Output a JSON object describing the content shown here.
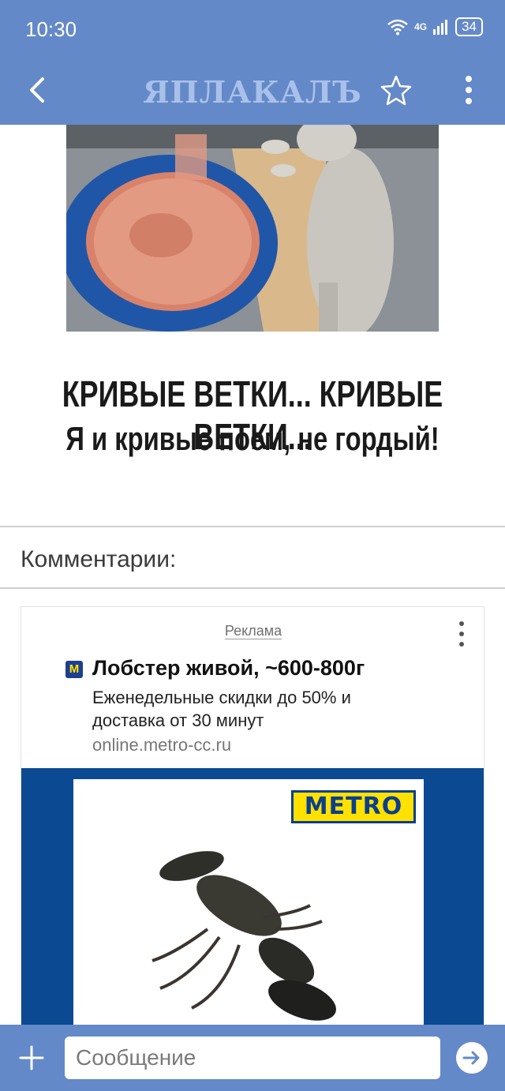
{
  "status_bar": {
    "time": "10:30",
    "network": "4G",
    "battery": "34"
  },
  "app_bar": {
    "logo_text": "ЯПЛАКАЛЪ",
    "back_icon": "chevron-left-icon",
    "favorite_icon": "star-outline-icon",
    "menu_icon": "more-vertical-icon"
  },
  "post": {
    "caption_line1": "КРИВЫЕ ВЕТКИ... КРИВЫЕ ВЕТКИ...",
    "caption_line2": "Я и кривые поем, не гордый!"
  },
  "comments": {
    "title": "Комментарии:"
  },
  "ad": {
    "label": "Реклама",
    "favicon_letter": "M",
    "title": "Лобстер живой, ~600-800г",
    "description": "Еженедельные скидки до 50% и доставка от 30 минут",
    "url": "online.metro-cc.ru",
    "banner_logo": "METRO"
  },
  "composer": {
    "placeholder": "Сообщение",
    "add_icon": "plus-icon",
    "send_icon": "send-arrow-icon"
  },
  "colors": {
    "app_bar": "#6489c8",
    "logo": "#a9c1ea",
    "banner_blue": "#0b4a92",
    "metro_yellow": "#ffe100"
  }
}
